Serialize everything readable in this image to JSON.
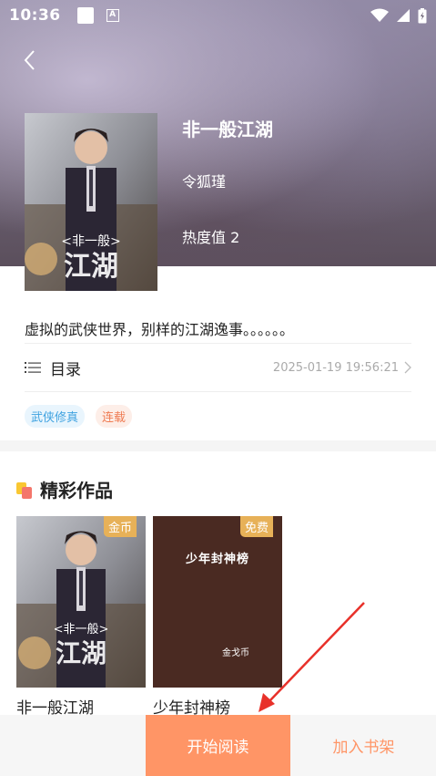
{
  "status_bar": {
    "time": "10:36",
    "a_badge": "A"
  },
  "book": {
    "title": "非一般江湖",
    "author": "令狐瑾",
    "heat": "热度值 2",
    "cover_text": "<非一般>江湖",
    "description": "虚拟的武侠世界，别样的江湖逸事。。。。。。"
  },
  "toc": {
    "label": "目录",
    "updated": "2025-01-19 19:56:21"
  },
  "tags": [
    "武侠修真",
    "连载"
  ],
  "section": {
    "title": "精彩作品"
  },
  "works": [
    {
      "name": "非一般江湖",
      "badge": "金币",
      "cover_text": "<非一般>江湖"
    },
    {
      "name": "少年封神榜",
      "badge": "免费",
      "cover_title": "少年封神榜",
      "cover_author": "金戈币"
    }
  ],
  "actions": {
    "read": "开始阅读",
    "shelf": "加入书架"
  },
  "colors": {
    "accent": "#ff9566",
    "badge": "#e7b158",
    "arrow": "#e8312a"
  }
}
